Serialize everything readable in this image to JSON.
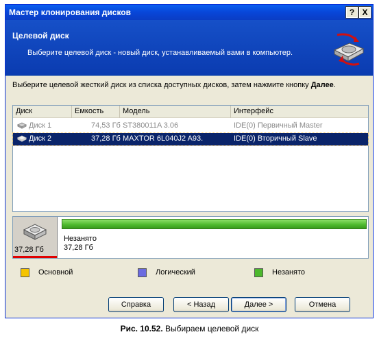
{
  "window": {
    "title": "Мастер клонирования дисков",
    "help_btn": "?",
    "close_btn": "X"
  },
  "header": {
    "title": "Целевой диск",
    "subtitle": "Выберите целевой диск - новый диск, устанавливаемый вами в компьютер."
  },
  "instruction": {
    "text": "Выберите целевой жесткий диск из списка доступных дисков, затем нажмите кнопку ",
    "bold": "Далее",
    "end": "."
  },
  "table": {
    "columns": [
      "Диск",
      "Емкость",
      "Модель",
      "Интерфейс"
    ],
    "rows": [
      {
        "disk": "Диск 1",
        "capacity": "74,53 Гб",
        "model": "ST380011A 3.06",
        "interface": "IDE(0) Первичный Master",
        "state": "disabled"
      },
      {
        "disk": "Диск 2",
        "capacity": "37,28 Гб",
        "model": "MAXTOR 6L040J2 A93.",
        "interface": "IDE(0) Вторичный Slave",
        "state": "selected"
      }
    ]
  },
  "disk_panel": {
    "size": "37,28 Гб",
    "partition_label": "Незанято",
    "partition_size": "37,28 Гб"
  },
  "legend": [
    {
      "label": "Основной",
      "color": "#f5c400"
    },
    {
      "label": "Логический",
      "color": "#6b6be0"
    },
    {
      "label": "Незанято",
      "color": "#4cb82c"
    }
  ],
  "buttons": {
    "help": "Справка",
    "back": "< Назад",
    "next": "Далее >",
    "cancel": "Отмена"
  },
  "caption": {
    "bold": "Рис. 10.52.",
    "text": " Выбираем целевой диск"
  }
}
